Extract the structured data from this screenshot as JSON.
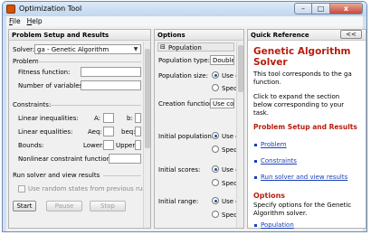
{
  "window": {
    "title": "Optimization Tool",
    "controls": {
      "minimize": "–",
      "maximize": "□",
      "close": "x"
    }
  },
  "menu": [
    {
      "prefix": "F",
      "rest": "ile"
    },
    {
      "prefix": "H",
      "rest": "elp"
    }
  ],
  "problem_panel": {
    "header": "Problem Setup and Results",
    "solver_label": "Solver:",
    "solver_value": "ga - Genetic Algorithm",
    "problem_group": "Problem",
    "fitness_label": "Fitness function:",
    "variables_label": "Number of variables:",
    "constraints_group": "Constraints:",
    "lin_ineq_label": "Linear inequalities:",
    "lin_ineq_a": "A:",
    "lin_ineq_b": "b:",
    "lin_eq_label": "Linear equalities:",
    "lin_eq_aeq": "Aeq:",
    "lin_eq_beq": "beq:",
    "bounds_label": "Bounds:",
    "bounds_lower": "Lower:",
    "bounds_upper": "Upper:",
    "nonlin_label": "Nonlinear constraint function:",
    "run_group": "Run solver and view results",
    "random_states_label": "Use random states from previous run",
    "start": "Start",
    "pause": "Pause",
    "stop": "Stop"
  },
  "options_panel": {
    "header": "Options",
    "section": "Population",
    "population_type_label": "Population type:",
    "population_type_value": "Double",
    "population_size_label": "Population size:",
    "use_default": "Use d",
    "specify": "Spec",
    "creation_label": "Creation function:",
    "creation_value": "Use cor",
    "initial_population_label": "Initial population:",
    "initial_scores_label": "Initial scores:",
    "initial_range_label": "Initial range:"
  },
  "quick_reference": {
    "header": "Quick Reference",
    "collapse_button": "<<",
    "title": "Genetic Algorithm Solver",
    "intro": "This tool corresponds to the ga function.",
    "instructions": "Click to expand the section below corresponding to your task.",
    "section1_title": "Problem Setup and Results",
    "links1": [
      "Problem",
      "Constraints",
      "Run solver and view results"
    ],
    "section2_title": "Options",
    "options_text": "Specify options for the Genetic Algorithm solver.",
    "links2": [
      "Population"
    ]
  }
}
